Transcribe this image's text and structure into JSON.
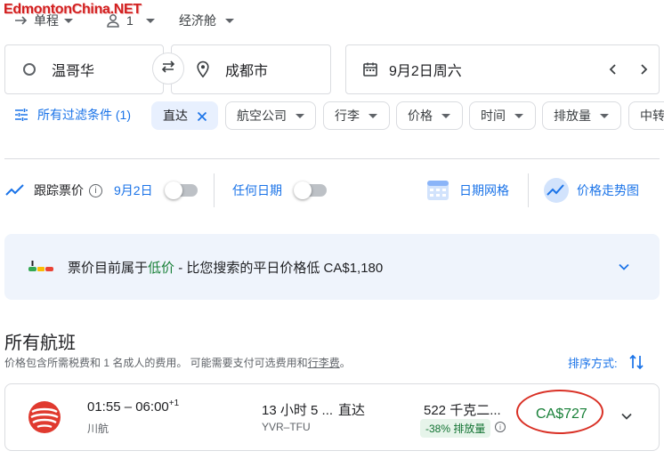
{
  "watermark": "EdmontonChina.NET",
  "top": {
    "trip_type": "单程",
    "passengers": "1",
    "cabin": "经济舱"
  },
  "search": {
    "origin": "温哥华",
    "destination": "成都市",
    "date": "9月2日周六"
  },
  "filters": {
    "all_filters_label": "所有过滤条件 (1)",
    "chips": [
      "直达",
      "航空公司",
      "行李",
      "价格",
      "时间",
      "排放量",
      "中转"
    ]
  },
  "tracking": {
    "track_label": "跟踪票价",
    "date_label": "9月2日",
    "any_date_label": "任何日期",
    "date_grid_label": "日期网格",
    "price_graph_label": "价格走势图"
  },
  "banner": {
    "text_before": "票价目前属于",
    "text_highlight": "低价",
    "text_after": " - 比您搜索的平日价格低 CA$1,180"
  },
  "results": {
    "heading": "所有航班",
    "note_prefix": "价格包含所需税费和 1 名成人的费用。 可能需要支付可选费用和",
    "note_link": "行李费",
    "note_suffix": "。",
    "sort_label": "排序方式:"
  },
  "flight": {
    "times": "01:55 – 06:00",
    "day_offset": "+1",
    "airline": "川航",
    "duration": "13 小时 5 ...",
    "stops": "直达",
    "route": "YVR–TFU",
    "emissions": "522 千克二...",
    "emissions_badge": "-38% 排放量",
    "price": "CA$727"
  },
  "colors": {
    "accent": "#1a73e8",
    "price_green": "#188038",
    "low_price_green": "#188038",
    "circle_red": "#d93025",
    "badge_bg": "#e6f4ea"
  }
}
